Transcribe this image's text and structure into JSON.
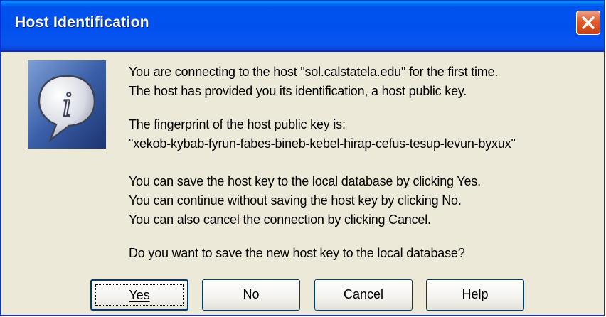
{
  "window": {
    "title": "Host Identification"
  },
  "message": {
    "line1": "You are connecting to the host \"sol.calstatela.edu\" for the first time.",
    "line2": "The host has provided you its identification, a host public key.",
    "line3": "The fingerprint of the host public key is:",
    "line4": "\"xekob-kybab-fyrun-fabes-bineb-kebel-hirap-cefus-tesup-levun-byxux\"",
    "line5": "You can save the host key to the local database by clicking Yes.",
    "line6": "You can continue without saving the host key by clicking No.",
    "line7": "You can also cancel the connection by clicking Cancel.",
    "line8": "Do you want to save the new host key to the local database?"
  },
  "buttons": {
    "yes": "Yes",
    "no": "No",
    "cancel": "Cancel",
    "help": "Help"
  },
  "colors": {
    "titlebar": "#0053ee",
    "dialog_bg": "#ece9d8",
    "close": "#e35a2b",
    "icon_bg": "#3a5fa8"
  },
  "icons": {
    "dialog": "info-icon",
    "close": "close-icon"
  }
}
